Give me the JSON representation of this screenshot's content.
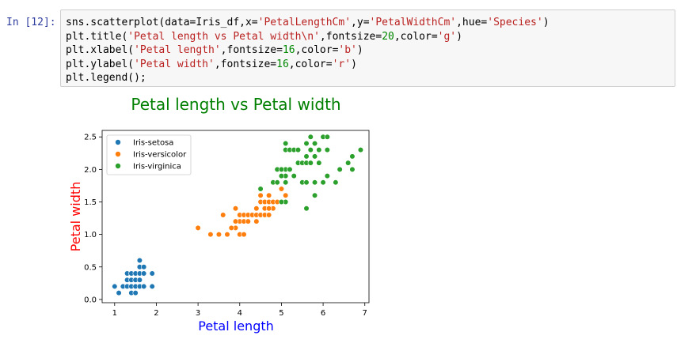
{
  "prompt": "In [12]:",
  "code_lines": [
    [
      {
        "t": "sns.scatterplot(data=Iris_df,x="
      },
      {
        "s": "'PetalLengthCm'"
      },
      {
        "t": ",y="
      },
      {
        "s": "'PetalWidthCm'"
      },
      {
        "t": ",hue="
      },
      {
        "s": "'Species'"
      },
      {
        "t": ")"
      }
    ],
    [
      {
        "t": "plt.title("
      },
      {
        "s": "'Petal length vs Petal width\\n'"
      },
      {
        "t": ",fontsize="
      },
      {
        "n": "20"
      },
      {
        "t": ",color="
      },
      {
        "s": "'g'"
      },
      {
        "t": ")"
      }
    ],
    [
      {
        "t": "plt.xlabel("
      },
      {
        "s": "'Petal length'"
      },
      {
        "t": ",fontsize="
      },
      {
        "n": "16"
      },
      {
        "t": ",color="
      },
      {
        "s": "'b'"
      },
      {
        "t": ")"
      }
    ],
    [
      {
        "t": "plt.ylabel("
      },
      {
        "s": "'Petal width'"
      },
      {
        "t": ",fontsize="
      },
      {
        "n": "16"
      },
      {
        "t": ",color="
      },
      {
        "s": "'r'"
      },
      {
        "t": ")"
      }
    ],
    [
      {
        "t": "plt.legend();"
      }
    ]
  ],
  "chart_data": {
    "type": "scatter",
    "title": "Petal length vs Petal width",
    "title_color": "#008000",
    "xlabel": "Petal length",
    "xlabel_color": "#0000ff",
    "ylabel": "Petal width",
    "ylabel_color": "#ff0000",
    "xlim": [
      0.7,
      7.1
    ],
    "ylim": [
      -0.05,
      2.6
    ],
    "xticks": [
      1,
      2,
      3,
      4,
      5,
      6,
      7
    ],
    "yticks": [
      0.0,
      0.5,
      1.0,
      1.5,
      2.0,
      2.5
    ],
    "ytick_labels": [
      "0.0",
      "0.5",
      "1.0",
      "1.5",
      "2.0",
      "2.5"
    ],
    "grid": false,
    "legend_position": "upper-left",
    "series": [
      {
        "name": "Iris-setosa",
        "color": "#1f77b4",
        "points": [
          [
            1.0,
            0.2
          ],
          [
            1.1,
            0.1
          ],
          [
            1.2,
            0.2
          ],
          [
            1.3,
            0.2
          ],
          [
            1.4,
            0.2
          ],
          [
            1.5,
            0.2
          ],
          [
            1.6,
            0.2
          ],
          [
            1.7,
            0.2
          ],
          [
            1.9,
            0.2
          ],
          [
            1.3,
            0.3
          ],
          [
            1.4,
            0.3
          ],
          [
            1.5,
            0.3
          ],
          [
            1.6,
            0.3
          ],
          [
            1.3,
            0.4
          ],
          [
            1.4,
            0.4
          ],
          [
            1.5,
            0.4
          ],
          [
            1.6,
            0.4
          ],
          [
            1.7,
            0.4
          ],
          [
            1.9,
            0.4
          ],
          [
            1.4,
            0.1
          ],
          [
            1.5,
            0.1
          ],
          [
            1.6,
            0.5
          ],
          [
            1.7,
            0.5
          ],
          [
            1.6,
            0.6
          ]
        ]
      },
      {
        "name": "Iris-versicolor",
        "color": "#ff7f0e",
        "points": [
          [
            3.0,
            1.1
          ],
          [
            3.3,
            1.0
          ],
          [
            3.5,
            1.0
          ],
          [
            3.7,
            1.0
          ],
          [
            3.9,
            1.1
          ],
          [
            4.0,
            1.0
          ],
          [
            4.1,
            1.0
          ],
          [
            3.6,
            1.3
          ],
          [
            3.8,
            1.1
          ],
          [
            4.0,
            1.2
          ],
          [
            4.1,
            1.2
          ],
          [
            4.2,
            1.2
          ],
          [
            4.4,
            1.2
          ],
          [
            4.5,
            1.7
          ],
          [
            3.9,
            1.2
          ],
          [
            3.9,
            1.4
          ],
          [
            4.0,
            1.3
          ],
          [
            4.1,
            1.3
          ],
          [
            4.2,
            1.3
          ],
          [
            4.3,
            1.3
          ],
          [
            4.4,
            1.3
          ],
          [
            4.5,
            1.3
          ],
          [
            4.6,
            1.3
          ],
          [
            4.7,
            1.3
          ],
          [
            4.8,
            1.4
          ],
          [
            4.4,
            1.4
          ],
          [
            4.6,
            1.4
          ],
          [
            4.7,
            1.4
          ],
          [
            4.9,
            1.5
          ],
          [
            5.0,
            1.5
          ],
          [
            5.1,
            1.6
          ],
          [
            4.5,
            1.5
          ],
          [
            4.6,
            1.5
          ],
          [
            4.7,
            1.5
          ],
          [
            4.8,
            1.5
          ],
          [
            4.9,
            1.5
          ],
          [
            4.5,
            1.6
          ],
          [
            4.7,
            1.6
          ],
          [
            4.8,
            1.8
          ],
          [
            5.0,
            1.7
          ]
        ]
      },
      {
        "name": "Iris-virginica",
        "color": "#2ca02c",
        "points": [
          [
            4.5,
            1.7
          ],
          [
            4.8,
            1.8
          ],
          [
            4.9,
            1.8
          ],
          [
            5.1,
            1.5
          ],
          [
            5.0,
            1.5
          ],
          [
            5.1,
            1.9
          ],
          [
            5.0,
            1.9
          ],
          [
            5.1,
            2.0
          ],
          [
            4.9,
            2.0
          ],
          [
            5.0,
            2.0
          ],
          [
            5.1,
            2.3
          ],
          [
            5.1,
            2.4
          ],
          [
            5.1,
            1.8
          ],
          [
            5.2,
            2.0
          ],
          [
            5.2,
            2.3
          ],
          [
            5.3,
            1.9
          ],
          [
            5.3,
            2.3
          ],
          [
            5.4,
            2.1
          ],
          [
            5.4,
            2.3
          ],
          [
            5.5,
            1.8
          ],
          [
            5.5,
            2.1
          ],
          [
            5.6,
            1.4
          ],
          [
            5.6,
            1.8
          ],
          [
            5.6,
            2.1
          ],
          [
            5.6,
            2.4
          ],
          [
            5.6,
            2.2
          ],
          [
            5.7,
            2.1
          ],
          [
            5.7,
            2.3
          ],
          [
            5.7,
            2.5
          ],
          [
            5.8,
            1.6
          ],
          [
            5.8,
            1.8
          ],
          [
            5.8,
            2.2
          ],
          [
            5.8,
            2.4
          ],
          [
            5.9,
            2.1
          ],
          [
            5.9,
            2.3
          ],
          [
            6.0,
            1.8
          ],
          [
            6.0,
            2.5
          ],
          [
            6.1,
            1.9
          ],
          [
            6.1,
            2.3
          ],
          [
            6.1,
            2.5
          ],
          [
            6.4,
            2.0
          ],
          [
            6.6,
            2.1
          ],
          [
            6.7,
            2.0
          ],
          [
            6.7,
            2.2
          ],
          [
            6.3,
            1.8
          ],
          [
            6.9,
            2.3
          ]
        ]
      }
    ]
  }
}
